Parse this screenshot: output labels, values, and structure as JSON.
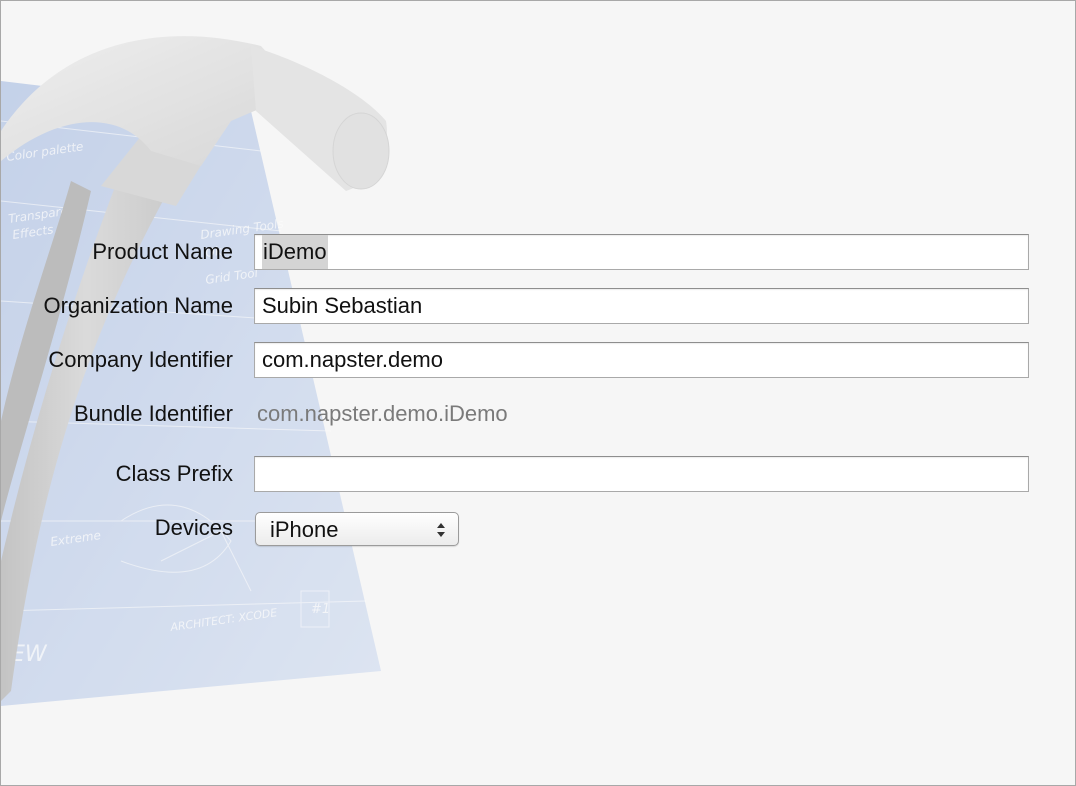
{
  "form": {
    "product_name": {
      "label": "Product Name",
      "value": "iDemo"
    },
    "organization_name": {
      "label": "Organization Name",
      "value": "Subin Sebastian"
    },
    "company_identifier": {
      "label": "Company Identifier",
      "value": "com.napster.demo"
    },
    "bundle_identifier": {
      "label": "Bundle Identifier",
      "value": "com.napster.demo.iDemo"
    },
    "class_prefix": {
      "label": "Class Prefix",
      "value": ""
    },
    "devices": {
      "label": "Devices",
      "selected": "iPhone"
    }
  },
  "watermark": {
    "icon": "xcode-hammer-blueprint-icon",
    "text_fragments": [
      "Color palette",
      "Transparent Effects",
      "Drawing Tools",
      "Ok",
      "Grid Tool",
      "Extreme",
      "ARCHITECT: XCODE",
      "#1",
      "EW"
    ]
  },
  "colors": {
    "background": "#f6f6f6",
    "blueprint": "#8fa9d8",
    "field_border": "#a9a9a9",
    "selection": "#d4d4d4",
    "static_value": "#7a7a7a"
  }
}
